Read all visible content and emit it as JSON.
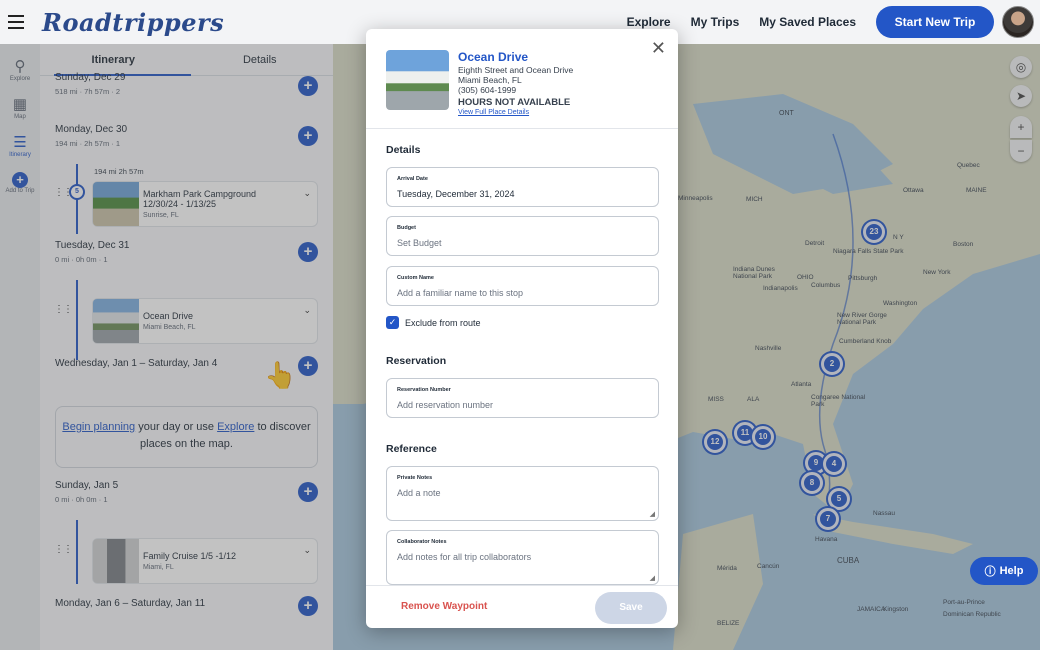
{
  "app": {
    "logo": "Roadtrippers"
  },
  "nav": {
    "explore": "Explore",
    "my_trips": "My Trips",
    "saved": "My Saved Places",
    "start": "Start New Trip"
  },
  "rail": [
    {
      "label": "Explore",
      "icon": "search-icon"
    },
    {
      "label": "Map",
      "icon": "map-icon"
    },
    {
      "label": "Itinerary",
      "icon": "list-icon"
    },
    {
      "label": "Add to Trip",
      "icon": "plus-icon"
    }
  ],
  "sidebar": {
    "tabs": [
      "Itinerary",
      "Details"
    ],
    "days": [
      {
        "title": "Sunday, Dec 29",
        "meta": "518 mi  ·  7h 57m  ·  2"
      },
      {
        "title": "Monday, Dec 30",
        "meta": "194 mi  ·  2h 57m  ·  1"
      },
      {
        "title": "Tuesday, Dec 31",
        "meta": "0 mi  ·  0h 0m  ·  1"
      },
      {
        "title": "Wednesday, Jan 1 – Saturday, Jan 4",
        "meta": ""
      },
      {
        "title": "Sunday, Jan 5",
        "meta": "0 mi  ·  0h 0m  ·  1"
      },
      {
        "title": "Monday, Jan 6 – Saturday, Jan 11",
        "meta": ""
      }
    ],
    "leg": "194 mi   2h 57m",
    "stop_number": "5",
    "stops": [
      {
        "name": "Markham Park Campground 12/30/24 - 1/13/25",
        "location": "Sunrise, FL"
      },
      {
        "name": "Ocean Drive",
        "location": "Miami Beach, FL"
      },
      {
        "name": "Family Cruise 1/5 -1/12",
        "location": "Miami, FL"
      }
    ],
    "plan": {
      "link1": "Begin planning",
      "mid": " your day or use ",
      "link2": "Explore",
      "end": " to discover places on the map."
    }
  },
  "map": {
    "clusters": [
      "23",
      "2",
      "12",
      "11",
      "10",
      "9",
      "4",
      "8",
      "5",
      "7"
    ],
    "labels": [
      "ONT",
      "Quebec",
      "Ottawa",
      "MAINE",
      "Minneapolis",
      "MICH",
      "Detroit",
      "Niagara Falls State Park",
      "N Y",
      "Boston",
      "New York",
      "Pittsburgh",
      "Indiana Dunes National Park",
      "Indianapolis",
      "Columbus",
      "OHIO",
      "Washington",
      "New River Gorge National Park",
      "Cumberland Knob",
      "Nashville",
      "Atlanta",
      "Congaree National Park",
      "MISS",
      "ALA",
      "Havana",
      "CUBA",
      "Mérida",
      "Cancún",
      "BELIZE",
      "Kingston",
      "Nassau",
      "JAMAICA",
      "Port-au-Prince",
      "Dominican Republic"
    ],
    "help": "Help"
  },
  "modal": {
    "title": "Ocean Drive",
    "address1": "Eighth Street and Ocean Drive",
    "address2": "Miami Beach, FL",
    "phone": "(305) 604-1999",
    "hours": "HOURS NOT AVAILABLE",
    "link": "View Full Place Details",
    "sections": {
      "details": "Details",
      "reservation": "Reservation",
      "reference": "Reference"
    },
    "arrival": {
      "label": "Arrival Date",
      "value": "Tuesday, December 31, 2024"
    },
    "budget": {
      "label": "Budget",
      "placeholder": "Set Budget"
    },
    "custom": {
      "label": "Custom Name",
      "placeholder": "Add a familiar name to this stop"
    },
    "exclude": "Exclude from route",
    "reservation": {
      "label": "Reservation Number",
      "placeholder": "Add reservation number"
    },
    "private": {
      "label": "Private Notes",
      "placeholder": "Add a note"
    },
    "collab": {
      "label": "Collaborator Notes",
      "placeholder": "Add notes for all trip collaborators"
    },
    "remove": "Remove Waypoint",
    "save": "Save"
  },
  "colors": {
    "accent": "#2356c7",
    "danger": "#d9534f"
  }
}
